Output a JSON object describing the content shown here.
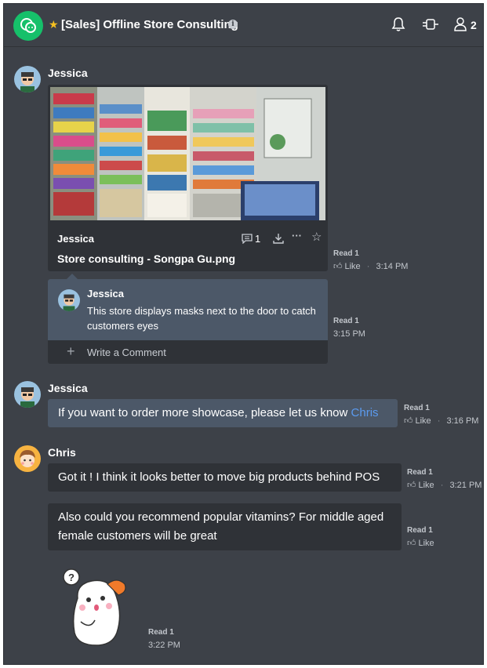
{
  "header": {
    "title": "[Sales] Offline Store Consulting",
    "member_count": "2",
    "accent_color": "#16c06a",
    "icons": [
      "chat-logo-icon",
      "star-icon",
      "info-icon",
      "bell-icon",
      "plug-icon",
      "members-icon"
    ]
  },
  "messages": {
    "m1": {
      "sender": "Jessica",
      "file": {
        "owner": "Jessica",
        "name": "Store consulting - Songpa Gu.png",
        "comment_count": "1"
      },
      "read": "Read 1",
      "like": "Like",
      "time": "3:14 PM"
    },
    "comment": {
      "author": "Jessica",
      "text": "This store displays masks next to the door to catch customers eyes",
      "read": "Read 1",
      "time": "3:15 PM",
      "write_placeholder": "Write a Comment"
    },
    "m2": {
      "sender": "Jessica",
      "text": "If you want to order more showcase, please let us know",
      "mention": "Chris",
      "read": "Read 1",
      "like": "Like",
      "time": "3:16 PM"
    },
    "m3": {
      "sender": "Chris",
      "text": "Got it ! I think it looks better to move big products behind POS",
      "read": "Read 1",
      "like": "Like",
      "time": "3:21 PM"
    },
    "m4": {
      "text": "Also could you recommend popular vitamins? For middle aged female customers will be great",
      "read": "Read 1",
      "like": "Like"
    },
    "m5": {
      "sticker": "hamster-sticker",
      "sticker_glyph": "?",
      "read": "Read 1",
      "time": "3:22 PM"
    }
  }
}
